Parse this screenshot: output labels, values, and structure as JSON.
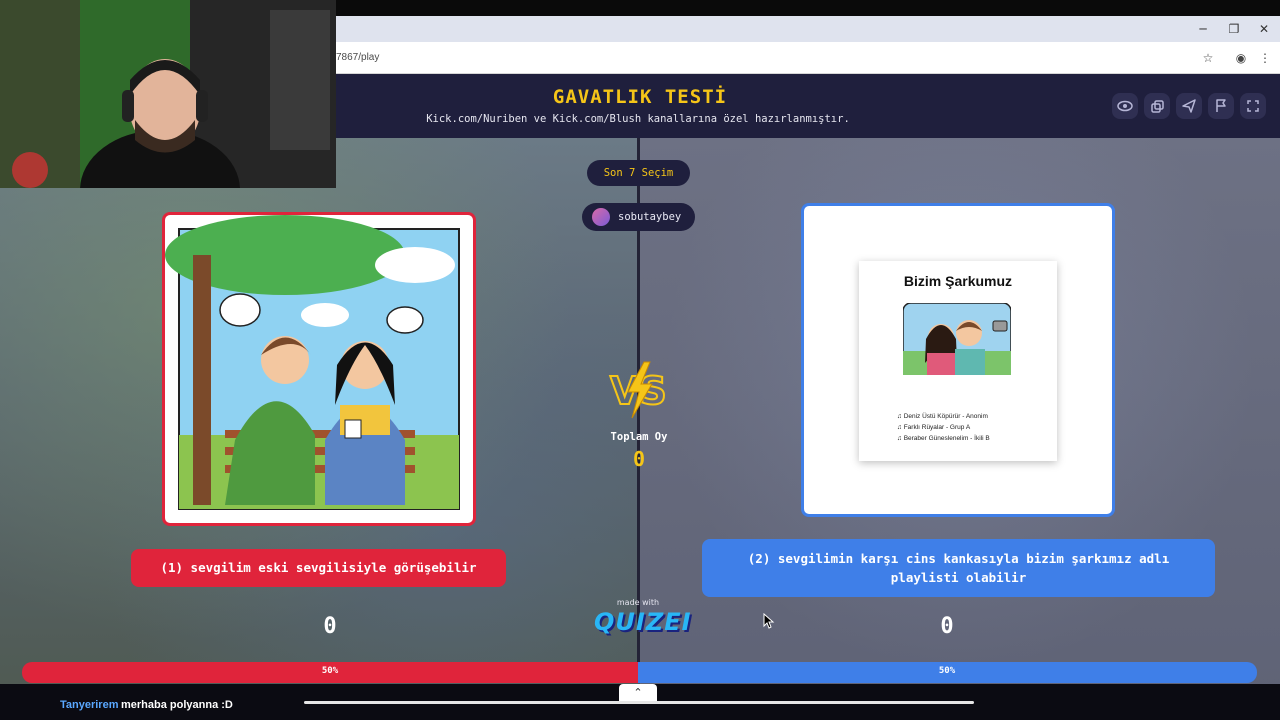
{
  "browser": {
    "url": "7867/play",
    "window_controls": [
      "minimize-icon",
      "restore-icon",
      "close-icon"
    ]
  },
  "header": {
    "title": "GAVATLIK TESTİ",
    "subtitle": "Kick.com/Nuriben ve Kick.com/Blush kanallarına özel hazırlanmıştır.",
    "icons": [
      "eye-icon",
      "share-icon",
      "send-icon",
      "flag-icon",
      "fullscreen-icon"
    ]
  },
  "arena": {
    "last_choices": "Son 7 Seçim",
    "username": "sobutaybey",
    "total_label": "Toplam Oy",
    "total_value": "0",
    "vs": "VS"
  },
  "left_option": {
    "label": "(1) sevgilim eski sevgilisiyle görüşebilir",
    "count": "0",
    "percent": "50%",
    "share": 0.5,
    "accent": "#e0243b"
  },
  "right_option": {
    "label": "(2) sevgilimin karşı cins kankasıyla bizim şarkımız adlı playlisti olabilir",
    "count": "0",
    "percent": "50%",
    "share": 0.5,
    "accent": "#3f7fe8",
    "image": {
      "title": "Bizim Şarkumuz",
      "tracks": [
        "Deniz Üstü Köpürür - Anonim",
        "Farklı Rüyalar - Grup A",
        "Beraber Güneslenelim - İkili B"
      ]
    }
  },
  "footer": {
    "made_with": "made with",
    "brand": "QUIZEI"
  },
  "chat": {
    "user": "Tanyerirem",
    "message": "merhaba polyanna :D"
  }
}
